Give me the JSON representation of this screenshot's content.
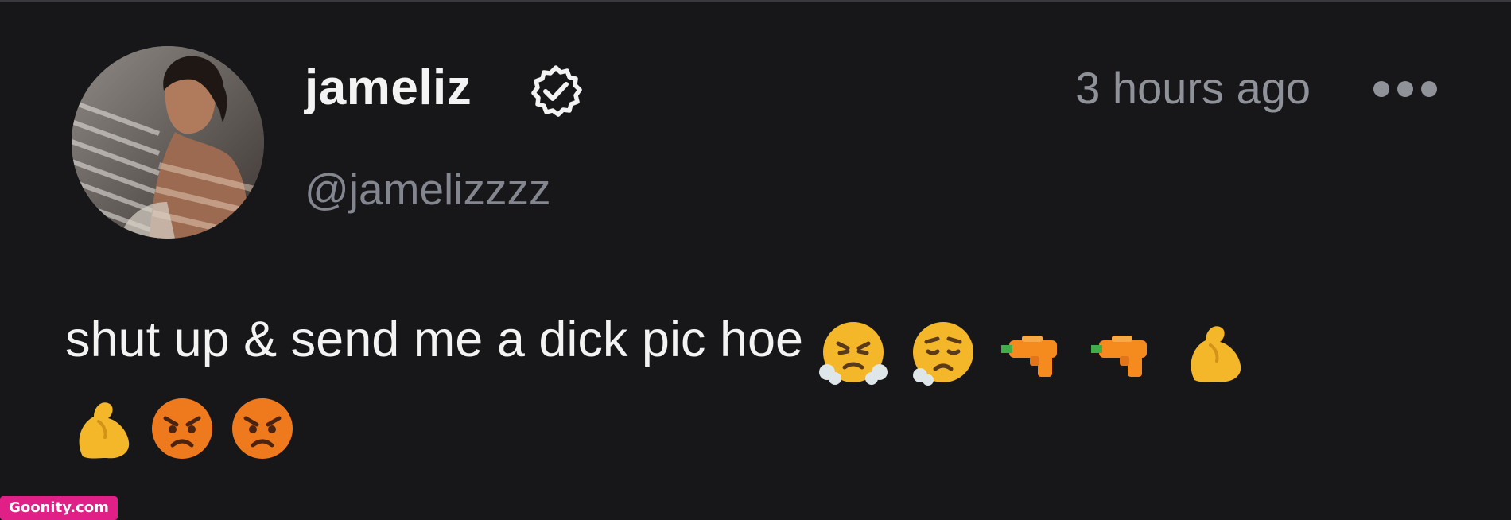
{
  "post": {
    "display_name": "jameliz",
    "handle": "@jamelizzzz",
    "timestamp": "3 hours ago",
    "text": "shut up & send me a dick pic hoe",
    "verified": true,
    "emojis_line1": [
      "face-with-steam-icon",
      "disappointed-relieved-icon",
      "water-pistol-icon",
      "water-pistol-icon",
      "flexed-biceps-icon"
    ],
    "emojis_line2": [
      "flexed-biceps-icon",
      "angry-face-icon",
      "angry-face-icon"
    ]
  },
  "watermark": {
    "text": "Goonity.com"
  },
  "colors": {
    "background": "#17171a",
    "primary_text": "#f3f3f3",
    "secondary_text": "#83868f",
    "watermark": "#e01f87"
  }
}
